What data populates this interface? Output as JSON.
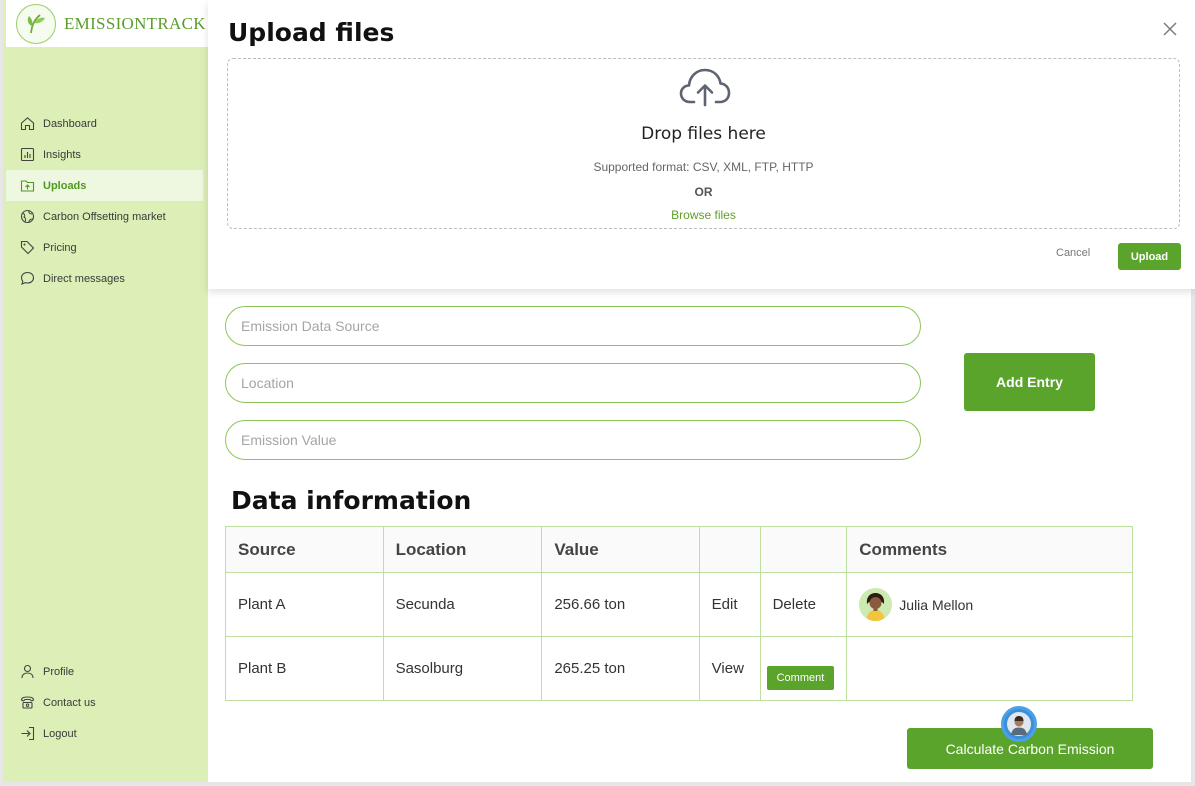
{
  "brand": {
    "name": "EMISSIONTRACK"
  },
  "sidebar": {
    "items": [
      {
        "label": "Dashboard",
        "icon": "home-icon"
      },
      {
        "label": "Insights",
        "icon": "chart-icon"
      },
      {
        "label": "Uploads",
        "icon": "upload-folder-icon",
        "active": true
      },
      {
        "label": "Carbon Offsetting market",
        "icon": "globe-icon"
      },
      {
        "label": "Pricing",
        "icon": "tag-icon"
      },
      {
        "label": "Direct messages",
        "icon": "chat-icon"
      }
    ],
    "bottom_items": [
      {
        "label": "Profile",
        "icon": "user-icon"
      },
      {
        "label": "Contact us",
        "icon": "phone-icon"
      },
      {
        "label": "Logout",
        "icon": "logout-icon"
      }
    ]
  },
  "modal": {
    "title": "Upload files",
    "drop_title": "Drop files here",
    "supported": "Supported format: CSV, XML, FTP, HTTP",
    "or_text": "OR",
    "browse": "Browse files",
    "cancel": "Cancel",
    "upload": "Upload"
  },
  "form": {
    "source_placeholder": "Emission Data Source",
    "location_placeholder": "Location",
    "value_placeholder": "Emission Value",
    "add_entry": "Add Entry"
  },
  "table": {
    "title": "Data information",
    "headers": [
      "Source",
      "Location",
      "Value",
      "",
      "",
      "Comments"
    ],
    "rows": [
      {
        "source": "Plant A",
        "location": "Secunda",
        "value": "256.66 ton",
        "action1": "Edit",
        "action2": "Delete",
        "comment_user": "Julia Mellon"
      },
      {
        "source": "Plant B",
        "location": "Sasolburg",
        "value": "265.25 ton",
        "action1": "View",
        "action2": "Comment",
        "comment_user": ""
      }
    ]
  },
  "calculate": {
    "label": "Calculate Carbon Emission"
  },
  "colors": {
    "accent": "#5aa42c",
    "sidebar_bg": "#dbefb6",
    "active_text": "#4e9a1f"
  }
}
